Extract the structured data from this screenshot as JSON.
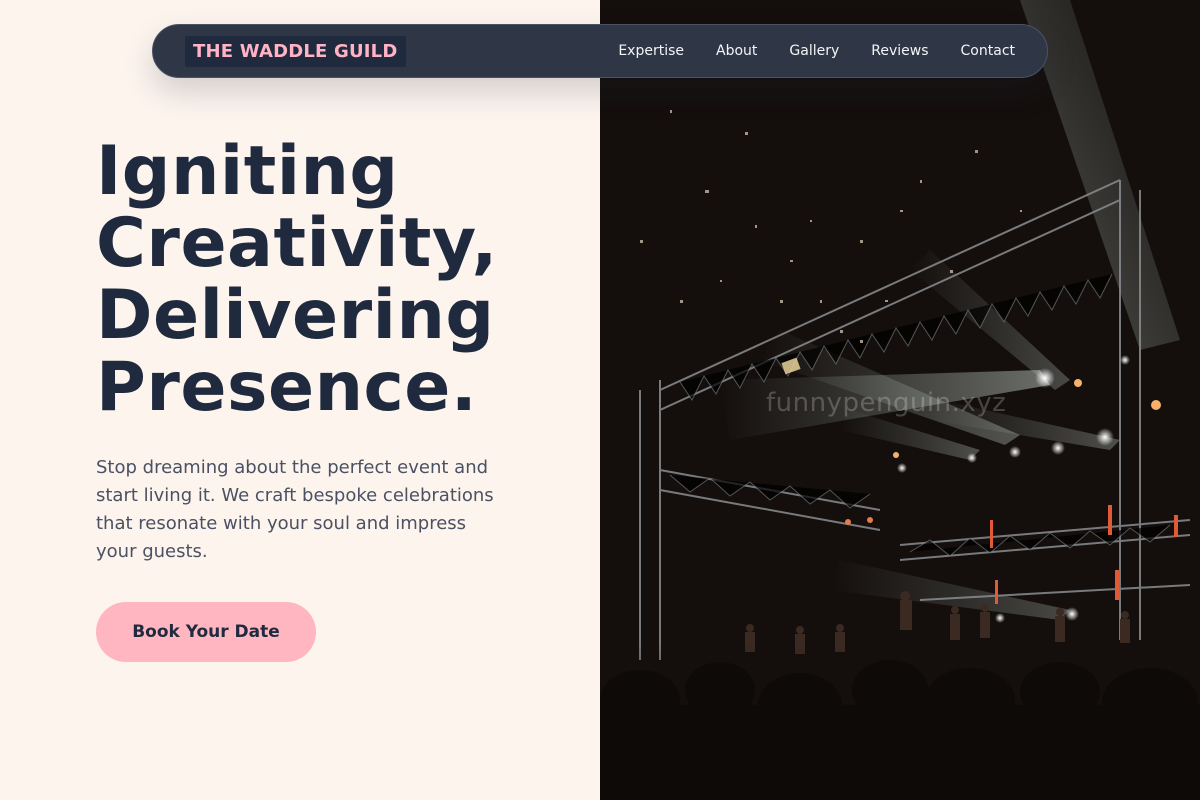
{
  "nav": {
    "logo": "THE WADDLE GUILD",
    "links": [
      "Expertise",
      "About",
      "Gallery",
      "Reviews",
      "Contact"
    ]
  },
  "hero": {
    "title_lines": [
      "Igniting",
      "Creativity,",
      "Delivering",
      "Presence."
    ],
    "subtitle": "Stop dreaming about the perfect event and start living it. We craft bespoke celebrations that resonate with your soul and impress your guests.",
    "cta_label": "Book Your Date"
  },
  "image": {
    "watermark": "funnypenguin.xyz",
    "subject": "concert stage with light beams"
  },
  "colors": {
    "page_bg": "#fdf4ee",
    "nav_bg": "#2f3747",
    "logo_text": "#ffb3c4",
    "title": "#1f2a3e",
    "cta_bg": "#ffb6c1"
  }
}
